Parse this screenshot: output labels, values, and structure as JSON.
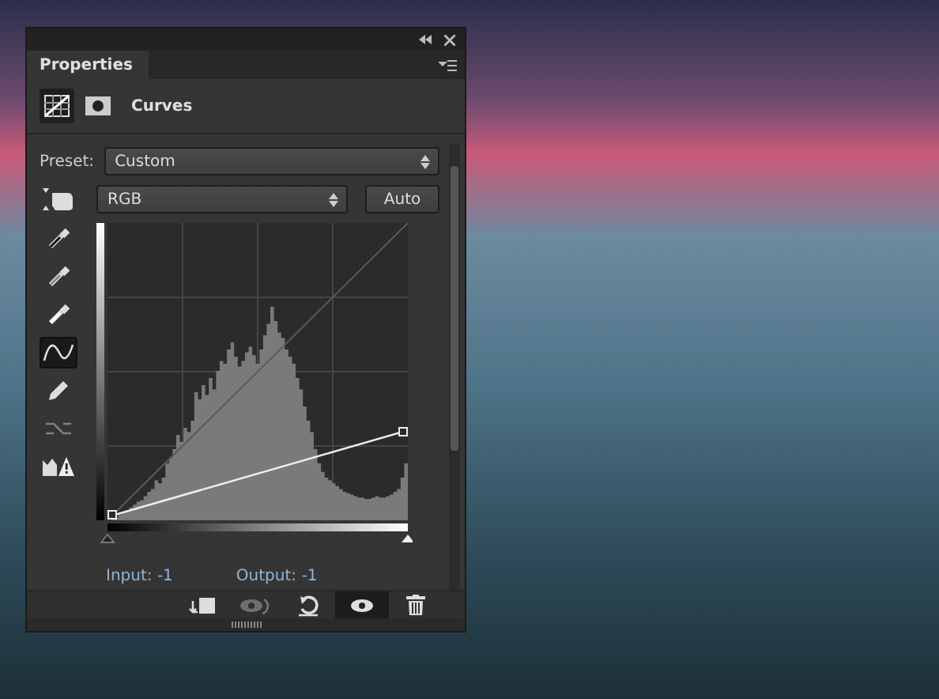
{
  "panel": {
    "tabs": [
      {
        "label": "Properties",
        "selected": true
      }
    ],
    "modes": [
      {
        "kind": "curves",
        "selected": true
      },
      {
        "kind": "mask",
        "selected": false
      }
    ],
    "adjustment_title": "Curves",
    "preset": {
      "label": "Preset:",
      "value": "Custom"
    },
    "channel": {
      "value": "RGB"
    },
    "auto_button": "Auto",
    "tools": [
      {
        "kind": "eyedropper-black",
        "selected": false,
        "disabled": false
      },
      {
        "kind": "eyedropper-gray",
        "selected": false,
        "disabled": false
      },
      {
        "kind": "eyedropper-white",
        "selected": false,
        "disabled": false
      },
      {
        "kind": "curve",
        "selected": true,
        "disabled": false
      },
      {
        "kind": "pencil",
        "selected": false,
        "disabled": false
      },
      {
        "kind": "smooth",
        "selected": false,
        "disabled": true
      },
      {
        "kind": "clipping",
        "selected": false,
        "disabled": false
      }
    ],
    "input_sliders": [
      {
        "level": 0
      },
      {
        "level": 1
      }
    ],
    "input_readout": "Input: -1",
    "output_readout": "Output: -1",
    "footer_buttons": [
      {
        "kind": "clip",
        "selected": false,
        "disabled": false
      },
      {
        "kind": "view-previous",
        "selected": false,
        "disabled": true
      },
      {
        "kind": "reset",
        "selected": false,
        "disabled": false
      },
      {
        "kind": "visibility",
        "selected": true,
        "disabled": false
      },
      {
        "kind": "delete",
        "selected": false,
        "disabled": false
      }
    ]
  }
}
